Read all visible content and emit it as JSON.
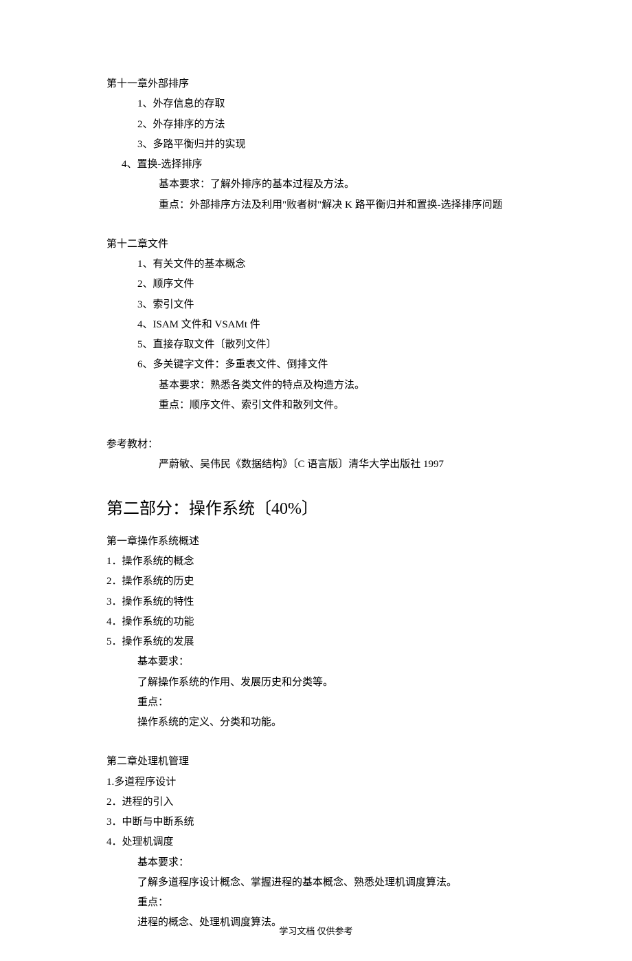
{
  "ch11": {
    "title": "第十一章外部排序",
    "items": [
      "1、外存信息的存取",
      "2、外存排序的方法",
      "3、多路平衡归并的实现"
    ],
    "item4": "4、置换-选择排序",
    "req": "基本要求：了解外排序的基本过程及方法。",
    "key": "重点：外部排序方法及利用\"败者树\"解决 K 路平衡归并和置换-选择排序问题"
  },
  "ch12": {
    "title": "第十二章文件",
    "items": [
      "1、有关文件的基本概念",
      "2、顺序文件",
      "3、索引文件",
      "4、ISAM 文件和 VSAMt 件",
      "5、直接存取文件〔散列文件〕",
      "6、多关键字文件：多重表文件、倒排文件"
    ],
    "req": "基本要求：熟悉各类文件的特点及构造方法。",
    "key": "重点：顺序文件、索引文件和散列文件。"
  },
  "ref": {
    "label": "参考教材：",
    "text": "严蔚敏、吴伟民《数据结构》〔C 语言版〕清华大学出版社 1997"
  },
  "part2": {
    "h": "第二部分：操作系统〔40%〕"
  },
  "os1": {
    "title": "第一章操作系统概述",
    "items": [
      "1．操作系统的概念",
      "2．操作系统的历史",
      "3．操作系统的特性",
      "4．操作系统的功能",
      "5．操作系统的发展"
    ],
    "reqLabel": "基本要求：",
    "req": "了解操作系统的作用、发展历史和分类等。",
    "keyLabel": "重点：",
    "key": "操作系统的定义、分类和功能。"
  },
  "os2": {
    "title": "第二章处理机管理",
    "items": [
      "1.多道程序设计",
      "2．进程的引入",
      "3．中断与中断系统",
      "4．处理机调度"
    ],
    "reqLabel": "基本要求：",
    "req": "了解多道程序设计概念、掌握进程的基本概念、熟悉处理机调度算法。",
    "keyLabel": "重点：",
    "key": "进程的概念、处理机调度算法。"
  },
  "footer": "学习文档  仅供参考"
}
